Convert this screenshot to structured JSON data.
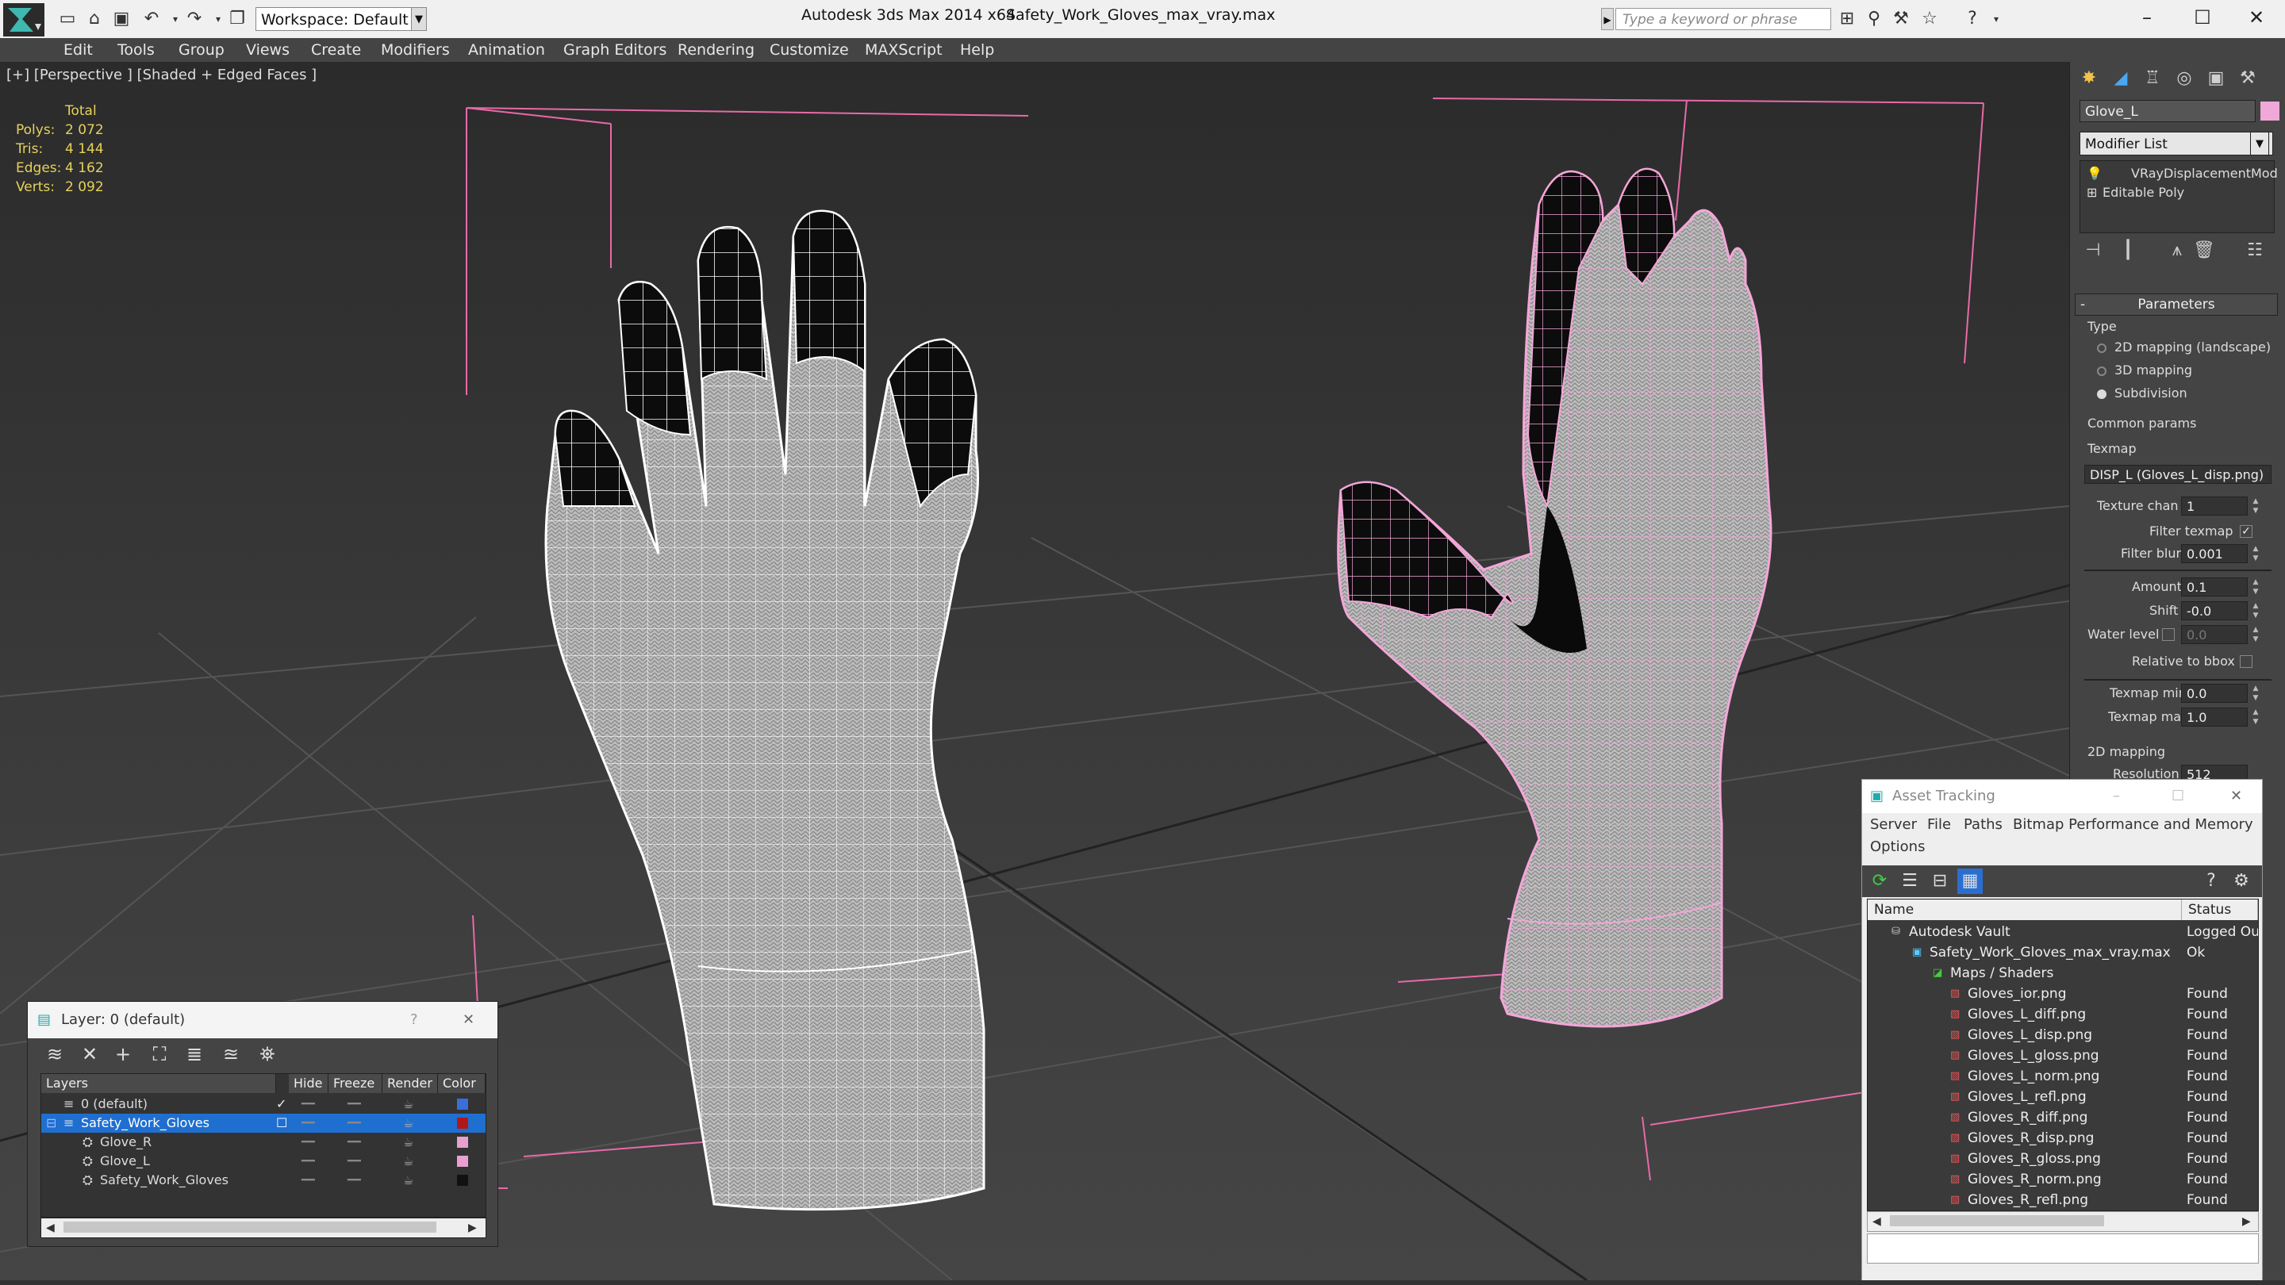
{
  "titlebar": {
    "app_title": "Autodesk 3ds Max  2014 x64",
    "file_title": "Safety_Work_Gloves_max_vray.max",
    "workspace": "Workspace: Default",
    "search_placeholder": "Type a keyword or phrase"
  },
  "menu": [
    "Edit",
    "Tools",
    "Group",
    "Views",
    "Create",
    "Modifiers",
    "Animation",
    "Graph Editors",
    "Rendering",
    "Customize",
    "MAXScript",
    "Help"
  ],
  "viewport": {
    "label": "[+] [Perspective ] [Shaded + Edged Faces ]",
    "stats": {
      "header": "Total",
      "rows": [
        {
          "label": "Polys:",
          "value": "2 072"
        },
        {
          "label": "Tris:",
          "value": "4 144"
        },
        {
          "label": "Edges:",
          "value": "4 162"
        },
        {
          "label": "Verts:",
          "value": "2 092"
        }
      ]
    }
  },
  "command_panel": {
    "object_name": "Glove_L",
    "object_color": "#f0a8d8",
    "modifier_list": "Modifier List",
    "stack": [
      "VRayDisplacementMod",
      "Editable Poly"
    ],
    "parameters": {
      "title": "Parameters",
      "type_label": "Type",
      "types": [
        {
          "label": "2D mapping (landscape)",
          "selected": false
        },
        {
          "label": "3D mapping",
          "selected": false
        },
        {
          "label": "Subdivision",
          "selected": true
        }
      ],
      "common_label": "Common params",
      "texmap_label": "Texmap",
      "texmap_value": "DISP_L (Gloves_L_disp.png)",
      "texture_chan_label": "Texture chan",
      "texture_chan": "1",
      "filter_texmap_label": "Filter texmap",
      "filter_blur_label": "Filter blur",
      "filter_blur": "0.001",
      "amount_label": "Amount",
      "amount": "0.1",
      "shift_label": "Shift",
      "shift": "-0.0",
      "water_level_label": "Water level",
      "water_level": "0.0",
      "relative_bbox_label": "Relative to bbox",
      "texmap_min_label": "Texmap min",
      "texmap_min": "0.0",
      "texmap_max_label": "Texmap max",
      "texmap_max": "1.0",
      "mapping2d_label": "2D mapping",
      "resolution_label": "Resolution",
      "resolution": "512"
    }
  },
  "layer_panel": {
    "title": "Layer: 0 (default)",
    "help": "?",
    "close": "✕",
    "columns": [
      "Layers",
      "Hide",
      "Freeze",
      "Render",
      "Color"
    ],
    "rows": [
      {
        "name": "0 (default)",
        "color": "#3a6ed8",
        "checked": true,
        "selected": false,
        "indent": 0
      },
      {
        "name": "Safety_Work_Gloves",
        "color": "#b01818",
        "checked": false,
        "selected": true,
        "indent": 0
      },
      {
        "name": "Glove_R",
        "color": "#e8a0d0",
        "checked": false,
        "selected": false,
        "indent": 1
      },
      {
        "name": "Glove_L",
        "color": "#e8a0d0",
        "checked": false,
        "selected": false,
        "indent": 1
      },
      {
        "name": "Safety_Work_Gloves",
        "color": "#111111",
        "checked": false,
        "selected": false,
        "indent": 1
      }
    ]
  },
  "asset_panel": {
    "title": "Asset Tracking",
    "menus": [
      "Server",
      "File",
      "Paths",
      "Bitmap Performance and Memory",
      "Options"
    ],
    "columns": [
      "Name",
      "Status"
    ],
    "rows": [
      {
        "name": "Autodesk Vault",
        "status": "Logged Ou",
        "level": 0
      },
      {
        "name": "Safety_Work_Gloves_max_vray.max",
        "status": "Ok",
        "level": 1
      },
      {
        "name": "Maps / Shaders",
        "status": "",
        "level": 2
      },
      {
        "name": "Gloves_ior.png",
        "status": "Found",
        "level": 3
      },
      {
        "name": "Gloves_L_diff.png",
        "status": "Found",
        "level": 3
      },
      {
        "name": "Gloves_L_disp.png",
        "status": "Found",
        "level": 3
      },
      {
        "name": "Gloves_L_gloss.png",
        "status": "Found",
        "level": 3
      },
      {
        "name": "Gloves_L_norm.png",
        "status": "Found",
        "level": 3
      },
      {
        "name": "Gloves_L_refl.png",
        "status": "Found",
        "level": 3
      },
      {
        "name": "Gloves_R_diff.png",
        "status": "Found",
        "level": 3
      },
      {
        "name": "Gloves_R_disp.png",
        "status": "Found",
        "level": 3
      },
      {
        "name": "Gloves_R_gloss.png",
        "status": "Found",
        "level": 3
      },
      {
        "name": "Gloves_R_norm.png",
        "status": "Found",
        "level": 3
      },
      {
        "name": "Gloves_R_refl.png",
        "status": "Found",
        "level": 3
      }
    ]
  },
  "icons": {
    "minimize": "–",
    "maximize": "☐",
    "close": "✕"
  }
}
